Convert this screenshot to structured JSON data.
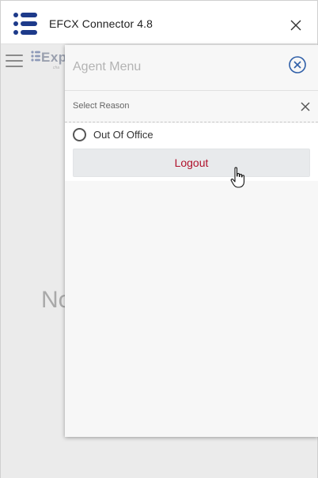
{
  "window": {
    "title": "EFCX Connector 4.8",
    "icons": {
      "logo": "expertflow-logo-icon",
      "close": "close-icon"
    }
  },
  "background_page": {
    "menu_icon": "hamburger-icon",
    "brand_text": "Exp",
    "brand_subtext": "cha",
    "partial_text": "No"
  },
  "agent_menu": {
    "title": "Agent Menu",
    "close_icon": "circle-x-icon",
    "select_reason": {
      "label": "Select Reason",
      "close_icon": "close-icon",
      "options": [
        {
          "label": "Out Of Office",
          "selected": false
        }
      ]
    },
    "logout_button": {
      "label": "Logout"
    }
  },
  "colors": {
    "logo_blue": "#1d3a8a",
    "logout_text": "#b0112b",
    "panel_close_blue": "#2f5fa8"
  }
}
